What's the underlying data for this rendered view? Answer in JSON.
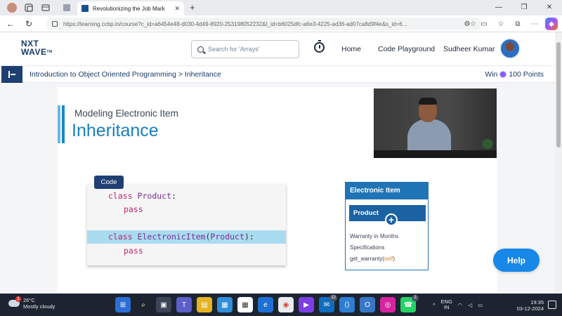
{
  "browser": {
    "tab_title": "Revolutionizing the Job Mark",
    "url": "https://learning.ccbp.in/course?c_id=a6454e48-d030-4d49-8920-253198052232&t_id=b6025dfc-a6e3-4225-ad36-ad07ca8d9f4e&s_id=6..."
  },
  "header": {
    "logo_line1": "NXT",
    "logo_line2": "WAVE",
    "logo_tm": "TM",
    "search_placeholder": "Search for 'Arrays'",
    "nav": [
      {
        "label": "Home"
      },
      {
        "label": "Code Playground"
      }
    ],
    "user_name": "Sudheer Kumar"
  },
  "breadcrumb": {
    "text": "Introduction to Object Oriented Programming > Inheritance",
    "win_label": "Win",
    "points": "100 Points"
  },
  "slide": {
    "subtitle": "Modeling Electronic Item",
    "title": "Inheritance",
    "code_tag": "Code",
    "code_lines": [
      {
        "kw": "class ",
        "cls": "Product",
        "rest": ":"
      },
      {
        "kw": "pass"
      },
      {
        "kw": "class ",
        "cls": "ElectronicItem",
        "paren_open": "(",
        "parent": "Product",
        "rest": "):"
      },
      {
        "kw": "pass"
      }
    ],
    "diagram": {
      "header": "Electronic Item",
      "sub_header": "Product",
      "items": [
        "Warranty in Months",
        "Specifications",
        "get_warranty("
      ],
      "self": "self",
      "close_paren": ")"
    }
  },
  "help_label": "Help",
  "taskbar": {
    "temperature": "26°C",
    "weather": "Mostly cloudy",
    "weather_badge": "1",
    "mail_count": "22",
    "whatsapp_count": "2",
    "lang_line1": "ENG",
    "lang_line2": "IN",
    "time": "19:35",
    "date": "03-12-2024"
  },
  "colors": {
    "brand_navy": "#1e3f73",
    "accent_blue": "#1980bf",
    "help_blue": "#1788e8",
    "code_highlight": "#a9dcf1",
    "keyword": "#c0266a",
    "class_name": "#7b2d8f"
  }
}
